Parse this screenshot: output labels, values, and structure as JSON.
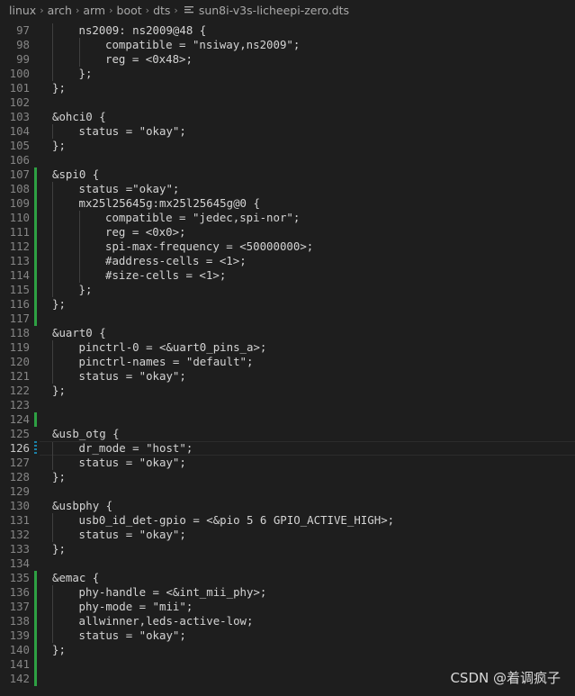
{
  "breadcrumb": {
    "items": [
      "linux",
      "arch",
      "arm",
      "boot",
      "dts"
    ],
    "file": "sun8i-v3s-licheepi-zero.dts",
    "separator": "›"
  },
  "editor": {
    "lines": [
      {
        "n": "97",
        "indent": 1,
        "code": "ns2009: ns2009@48 {",
        "mark": ""
      },
      {
        "n": "98",
        "indent": 2,
        "code": "compatible = \"nsiway,ns2009\";",
        "mark": ""
      },
      {
        "n": "99",
        "indent": 2,
        "code": "reg = <0x48>;",
        "mark": ""
      },
      {
        "n": "100",
        "indent": 1,
        "code": "};",
        "mark": ""
      },
      {
        "n": "101",
        "indent": 0,
        "code": "};",
        "mark": ""
      },
      {
        "n": "102",
        "indent": 0,
        "code": "",
        "mark": ""
      },
      {
        "n": "103",
        "indent": 0,
        "code": "&ohci0 {",
        "mark": ""
      },
      {
        "n": "104",
        "indent": 1,
        "code": "status = \"okay\";",
        "mark": ""
      },
      {
        "n": "105",
        "indent": 0,
        "code": "};",
        "mark": ""
      },
      {
        "n": "106",
        "indent": 0,
        "code": "",
        "mark": ""
      },
      {
        "n": "107",
        "indent": 0,
        "code": "&spi0 {",
        "mark": "added"
      },
      {
        "n": "108",
        "indent": 1,
        "code": "status =\"okay\";",
        "mark": "added"
      },
      {
        "n": "109",
        "indent": 1,
        "code": "mx25l25645g:mx25l25645g@0 {",
        "mark": "added"
      },
      {
        "n": "110",
        "indent": 2,
        "code": "compatible = \"jedec,spi-nor\";",
        "mark": "added"
      },
      {
        "n": "111",
        "indent": 2,
        "code": "reg = <0x0>;",
        "mark": "added"
      },
      {
        "n": "112",
        "indent": 2,
        "code": "spi-max-frequency = <50000000>;",
        "mark": "added"
      },
      {
        "n": "113",
        "indent": 2,
        "code": "#address-cells = <1>;",
        "mark": "added"
      },
      {
        "n": "114",
        "indent": 2,
        "code": "#size-cells = <1>;",
        "mark": "added"
      },
      {
        "n": "115",
        "indent": 1,
        "code": "};",
        "mark": "added"
      },
      {
        "n": "116",
        "indent": 0,
        "code": "};",
        "mark": "added"
      },
      {
        "n": "117",
        "indent": 0,
        "code": "",
        "mark": "added"
      },
      {
        "n": "118",
        "indent": 0,
        "code": "&uart0 {",
        "mark": ""
      },
      {
        "n": "119",
        "indent": 1,
        "code": "pinctrl-0 = <&uart0_pins_a>;",
        "mark": ""
      },
      {
        "n": "120",
        "indent": 1,
        "code": "pinctrl-names = \"default\";",
        "mark": ""
      },
      {
        "n": "121",
        "indent": 1,
        "code": "status = \"okay\";",
        "mark": ""
      },
      {
        "n": "122",
        "indent": 0,
        "code": "};",
        "mark": ""
      },
      {
        "n": "123",
        "indent": 0,
        "code": "",
        "mark": ""
      },
      {
        "n": "124",
        "indent": 0,
        "code": "",
        "mark": "added"
      },
      {
        "n": "125",
        "indent": 0,
        "code": "&usb_otg {",
        "mark": ""
      },
      {
        "n": "126",
        "indent": 1,
        "code": "dr_mode = \"host\";",
        "mark": "modified",
        "current": true
      },
      {
        "n": "127",
        "indent": 1,
        "code": "status = \"okay\";",
        "mark": ""
      },
      {
        "n": "128",
        "indent": 0,
        "code": "};",
        "mark": ""
      },
      {
        "n": "129",
        "indent": 0,
        "code": "",
        "mark": ""
      },
      {
        "n": "130",
        "indent": 0,
        "code": "&usbphy {",
        "mark": ""
      },
      {
        "n": "131",
        "indent": 1,
        "code": "usb0_id_det-gpio = <&pio 5 6 GPIO_ACTIVE_HIGH>;",
        "mark": ""
      },
      {
        "n": "132",
        "indent": 1,
        "code": "status = \"okay\";",
        "mark": ""
      },
      {
        "n": "133",
        "indent": 0,
        "code": "};",
        "mark": ""
      },
      {
        "n": "134",
        "indent": 0,
        "code": "",
        "mark": ""
      },
      {
        "n": "135",
        "indent": 0,
        "code": "&emac {",
        "mark": "added"
      },
      {
        "n": "136",
        "indent": 1,
        "code": "phy-handle = <&int_mii_phy>;",
        "mark": "added"
      },
      {
        "n": "137",
        "indent": 1,
        "code": "phy-mode = \"mii\";",
        "mark": "added"
      },
      {
        "n": "138",
        "indent": 1,
        "code": "allwinner,leds-active-low;",
        "mark": "added"
      },
      {
        "n": "139",
        "indent": 1,
        "code": "status = \"okay\";",
        "mark": "added"
      },
      {
        "n": "140",
        "indent": 0,
        "code": "};",
        "mark": "added"
      },
      {
        "n": "141",
        "indent": 0,
        "code": "",
        "mark": "added"
      },
      {
        "n": "142",
        "indent": 0,
        "code": "",
        "mark": "added"
      }
    ]
  },
  "colors": {
    "background": "#1e1e1e",
    "text": "#d4d4d4",
    "line_number": "#858585",
    "added_gutter": "#2ea043",
    "modified_gutter": "#1b81a8"
  },
  "watermark": {
    "text": "CSDN @着调疯子"
  }
}
